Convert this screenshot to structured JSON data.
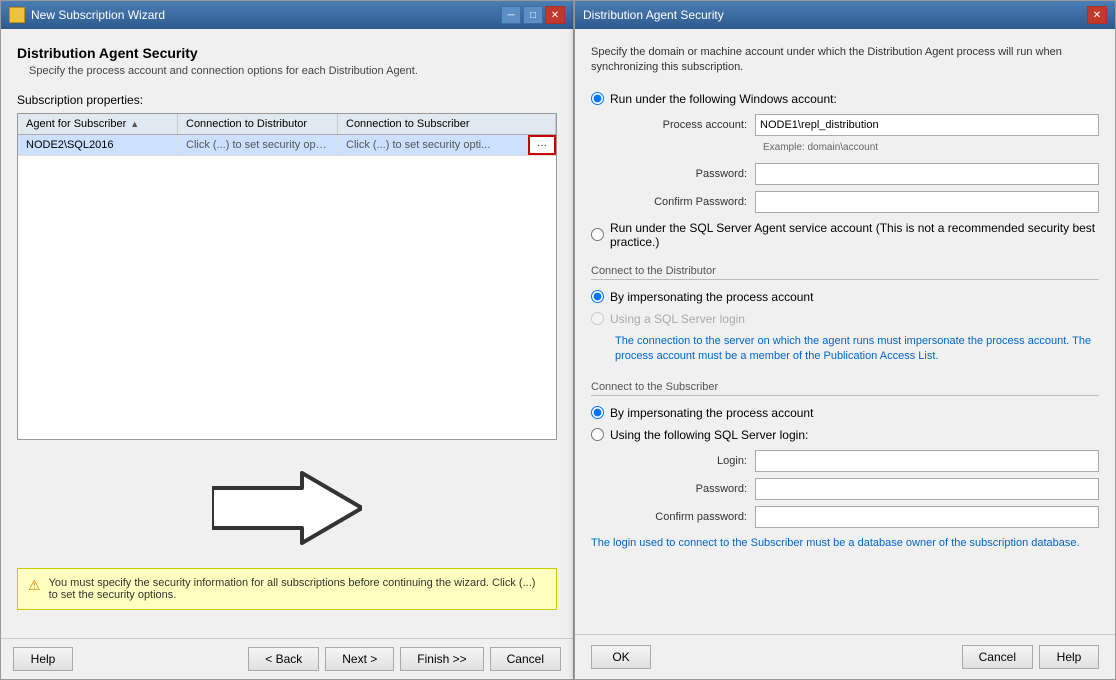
{
  "leftPanel": {
    "titleBar": {
      "title": "New Subscription Wizard",
      "icon": "wizard-icon",
      "controls": [
        "minimize",
        "maximize",
        "close"
      ]
    },
    "heading": "Distribution Agent Security",
    "subheading": "Specify the process account and connection options for each Distribution Agent.",
    "subscriptionProps": {
      "label": "Subscription properties:",
      "columns": [
        {
          "id": "agent",
          "label": "Agent for Subscriber",
          "sortable": true
        },
        {
          "id": "distributor",
          "label": "Connection to Distributor"
        },
        {
          "id": "subscriber",
          "label": "Connection to Subscriber"
        }
      ],
      "rows": [
        {
          "agent": "NODE2\\SQL2016",
          "distributor": "Click (...) to set security opti...",
          "subscriber": "Click (...) to set security opti...",
          "hasButton": true
        }
      ]
    },
    "warning": "You must specify the security information for all subscriptions before continuing the wizard. Click (...) to set the security options.",
    "buttons": {
      "help": "Help",
      "back": "< Back",
      "next": "Next >",
      "finish": "Finish >>",
      "cancel": "Cancel"
    }
  },
  "rightPanel": {
    "titleBar": {
      "title": "Distribution Agent Security",
      "controls": [
        "close"
      ]
    },
    "description": "Specify the domain or machine account under which the Distribution Agent process will run when synchronizing this subscription.",
    "windowsAccount": {
      "radioLabel": "Run under the following Windows account:",
      "processAccountLabel": "Process account:",
      "processAccountValue": "NODE1\\repl_distribution",
      "processAccountHint": "Example: domain\\account",
      "passwordLabel": "Password:",
      "confirmPasswordLabel": "Confirm Password:"
    },
    "sqlAgentOption": {
      "radioLabel": "Run under the SQL Server Agent service account (This is not a recommended security best practice.)"
    },
    "connectDistributor": {
      "label": "Connect to the Distributor",
      "option1": "By impersonating the process account",
      "option2": "Using a SQL Server login",
      "infoText": "The connection to the server on which the agent runs must impersonate the process account. The process account must be a member of the Publication Access List."
    },
    "connectSubscriber": {
      "label": "Connect to the Subscriber",
      "option1": "By impersonating the process account",
      "option2": "Using the following SQL Server login:",
      "loginLabel": "Login:",
      "passwordLabel": "Password:",
      "confirmPasswordLabel": "Confirm password:",
      "bottomText": "The login used to connect to the Subscriber must be a database owner of the subscription database."
    },
    "buttons": {
      "ok": "OK",
      "cancel": "Cancel",
      "help": "Help"
    }
  }
}
